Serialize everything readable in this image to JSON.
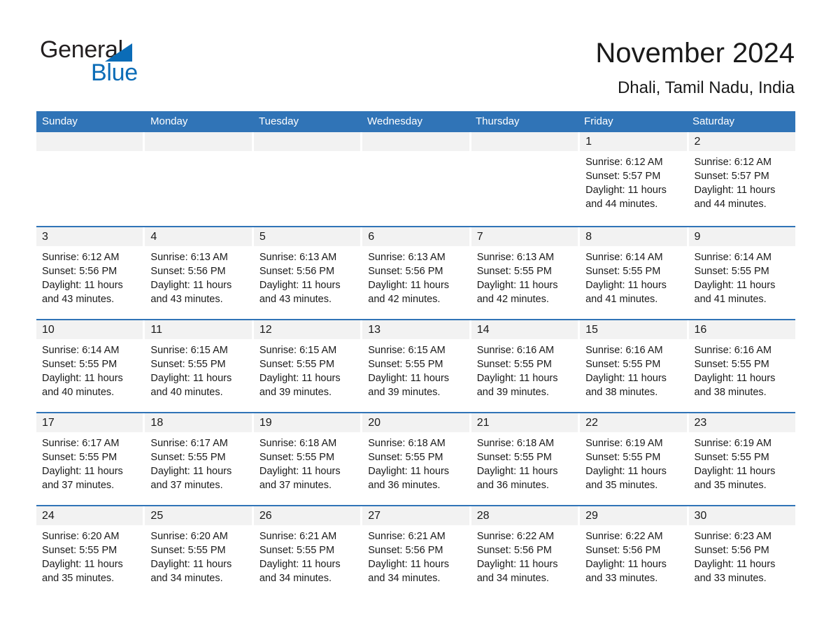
{
  "brand": {
    "name_part1": "General",
    "name_part2": "Blue",
    "triangle_icon": "triangle-icon",
    "accent_color": "#0b6cb7"
  },
  "header": {
    "title": "November 2024",
    "subtitle": "Dhali, Tamil Nadu, India"
  },
  "theme": {
    "header_blue": "#3074b7",
    "day_band_gray": "#f2f2f2",
    "text_color": "#1a1a1a"
  },
  "calendar": {
    "weekdays": [
      "Sunday",
      "Monday",
      "Tuesday",
      "Wednesday",
      "Thursday",
      "Friday",
      "Saturday"
    ],
    "weeks": [
      [
        {
          "day": "",
          "lines": []
        },
        {
          "day": "",
          "lines": []
        },
        {
          "day": "",
          "lines": []
        },
        {
          "day": "",
          "lines": []
        },
        {
          "day": "",
          "lines": []
        },
        {
          "day": "1",
          "lines": [
            "Sunrise: 6:12 AM",
            "Sunset: 5:57 PM",
            "Daylight: 11 hours and 44 minutes."
          ]
        },
        {
          "day": "2",
          "lines": [
            "Sunrise: 6:12 AM",
            "Sunset: 5:57 PM",
            "Daylight: 11 hours and 44 minutes."
          ]
        }
      ],
      [
        {
          "day": "3",
          "lines": [
            "Sunrise: 6:12 AM",
            "Sunset: 5:56 PM",
            "Daylight: 11 hours and 43 minutes."
          ]
        },
        {
          "day": "4",
          "lines": [
            "Sunrise: 6:13 AM",
            "Sunset: 5:56 PM",
            "Daylight: 11 hours and 43 minutes."
          ]
        },
        {
          "day": "5",
          "lines": [
            "Sunrise: 6:13 AM",
            "Sunset: 5:56 PM",
            "Daylight: 11 hours and 43 minutes."
          ]
        },
        {
          "day": "6",
          "lines": [
            "Sunrise: 6:13 AM",
            "Sunset: 5:56 PM",
            "Daylight: 11 hours and 42 minutes."
          ]
        },
        {
          "day": "7",
          "lines": [
            "Sunrise: 6:13 AM",
            "Sunset: 5:55 PM",
            "Daylight: 11 hours and 42 minutes."
          ]
        },
        {
          "day": "8",
          "lines": [
            "Sunrise: 6:14 AM",
            "Sunset: 5:55 PM",
            "Daylight: 11 hours and 41 minutes."
          ]
        },
        {
          "day": "9",
          "lines": [
            "Sunrise: 6:14 AM",
            "Sunset: 5:55 PM",
            "Daylight: 11 hours and 41 minutes."
          ]
        }
      ],
      [
        {
          "day": "10",
          "lines": [
            "Sunrise: 6:14 AM",
            "Sunset: 5:55 PM",
            "Daylight: 11 hours and 40 minutes."
          ]
        },
        {
          "day": "11",
          "lines": [
            "Sunrise: 6:15 AM",
            "Sunset: 5:55 PM",
            "Daylight: 11 hours and 40 minutes."
          ]
        },
        {
          "day": "12",
          "lines": [
            "Sunrise: 6:15 AM",
            "Sunset: 5:55 PM",
            "Daylight: 11 hours and 39 minutes."
          ]
        },
        {
          "day": "13",
          "lines": [
            "Sunrise: 6:15 AM",
            "Sunset: 5:55 PM",
            "Daylight: 11 hours and 39 minutes."
          ]
        },
        {
          "day": "14",
          "lines": [
            "Sunrise: 6:16 AM",
            "Sunset: 5:55 PM",
            "Daylight: 11 hours and 39 minutes."
          ]
        },
        {
          "day": "15",
          "lines": [
            "Sunrise: 6:16 AM",
            "Sunset: 5:55 PM",
            "Daylight: 11 hours and 38 minutes."
          ]
        },
        {
          "day": "16",
          "lines": [
            "Sunrise: 6:16 AM",
            "Sunset: 5:55 PM",
            "Daylight: 11 hours and 38 minutes."
          ]
        }
      ],
      [
        {
          "day": "17",
          "lines": [
            "Sunrise: 6:17 AM",
            "Sunset: 5:55 PM",
            "Daylight: 11 hours and 37 minutes."
          ]
        },
        {
          "day": "18",
          "lines": [
            "Sunrise: 6:17 AM",
            "Sunset: 5:55 PM",
            "Daylight: 11 hours and 37 minutes."
          ]
        },
        {
          "day": "19",
          "lines": [
            "Sunrise: 6:18 AM",
            "Sunset: 5:55 PM",
            "Daylight: 11 hours and 37 minutes."
          ]
        },
        {
          "day": "20",
          "lines": [
            "Sunrise: 6:18 AM",
            "Sunset: 5:55 PM",
            "Daylight: 11 hours and 36 minutes."
          ]
        },
        {
          "day": "21",
          "lines": [
            "Sunrise: 6:18 AM",
            "Sunset: 5:55 PM",
            "Daylight: 11 hours and 36 minutes."
          ]
        },
        {
          "day": "22",
          "lines": [
            "Sunrise: 6:19 AM",
            "Sunset: 5:55 PM",
            "Daylight: 11 hours and 35 minutes."
          ]
        },
        {
          "day": "23",
          "lines": [
            "Sunrise: 6:19 AM",
            "Sunset: 5:55 PM",
            "Daylight: 11 hours and 35 minutes."
          ]
        }
      ],
      [
        {
          "day": "24",
          "lines": [
            "Sunrise: 6:20 AM",
            "Sunset: 5:55 PM",
            "Daylight: 11 hours and 35 minutes."
          ]
        },
        {
          "day": "25",
          "lines": [
            "Sunrise: 6:20 AM",
            "Sunset: 5:55 PM",
            "Daylight: 11 hours and 34 minutes."
          ]
        },
        {
          "day": "26",
          "lines": [
            "Sunrise: 6:21 AM",
            "Sunset: 5:55 PM",
            "Daylight: 11 hours and 34 minutes."
          ]
        },
        {
          "day": "27",
          "lines": [
            "Sunrise: 6:21 AM",
            "Sunset: 5:56 PM",
            "Daylight: 11 hours and 34 minutes."
          ]
        },
        {
          "day": "28",
          "lines": [
            "Sunrise: 6:22 AM",
            "Sunset: 5:56 PM",
            "Daylight: 11 hours and 34 minutes."
          ]
        },
        {
          "day": "29",
          "lines": [
            "Sunrise: 6:22 AM",
            "Sunset: 5:56 PM",
            "Daylight: 11 hours and 33 minutes."
          ]
        },
        {
          "day": "30",
          "lines": [
            "Sunrise: 6:23 AM",
            "Sunset: 5:56 PM",
            "Daylight: 11 hours and 33 minutes."
          ]
        }
      ]
    ]
  }
}
